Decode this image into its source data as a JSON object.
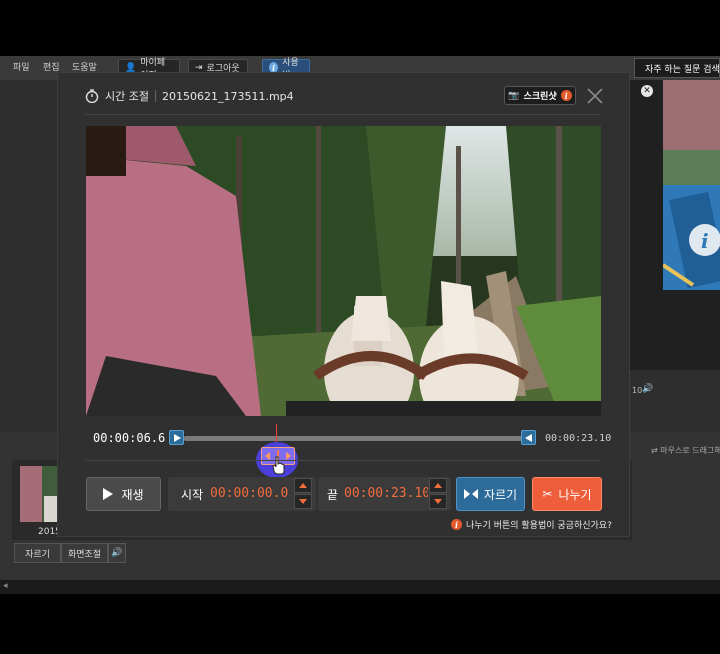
{
  "menu": [
    "파일",
    "편집",
    "도움말"
  ],
  "top_buttons": {
    "mypage": "마이페이지",
    "logout": "로그아웃",
    "usage": "사용법"
  },
  "faq": "자주 하는 질문 검색",
  "drag_hint": "마우스로 드래그해",
  "right_time": "10",
  "bottom": {
    "thumb_label": "2015",
    "crop_label": "자르기",
    "screen_label": "화면조절"
  },
  "modal": {
    "title": "시간 조절",
    "filename": "20150621_173511.mp4",
    "screenshot_label": "스크린샷",
    "info_glyph": "i"
  },
  "timeline": {
    "current": "00:00:06.6",
    "end": "00:00:23.10",
    "position": 0.28
  },
  "controls": {
    "play_label": "재생",
    "start_label": "시작",
    "start_value": "00:00:00.0",
    "end_label": "끝",
    "end_value": "00:00:23.10",
    "cut_label": "자르기",
    "split_label": "나누기"
  },
  "help_text": "나누기 버튼의 활용법이 궁금하신가요?",
  "colors": {
    "accent_blue": "#2d6b9a",
    "accent_orange": "#ef5e3b",
    "time_orange": "#f26d3c",
    "playhead_red": "#e9443b"
  }
}
